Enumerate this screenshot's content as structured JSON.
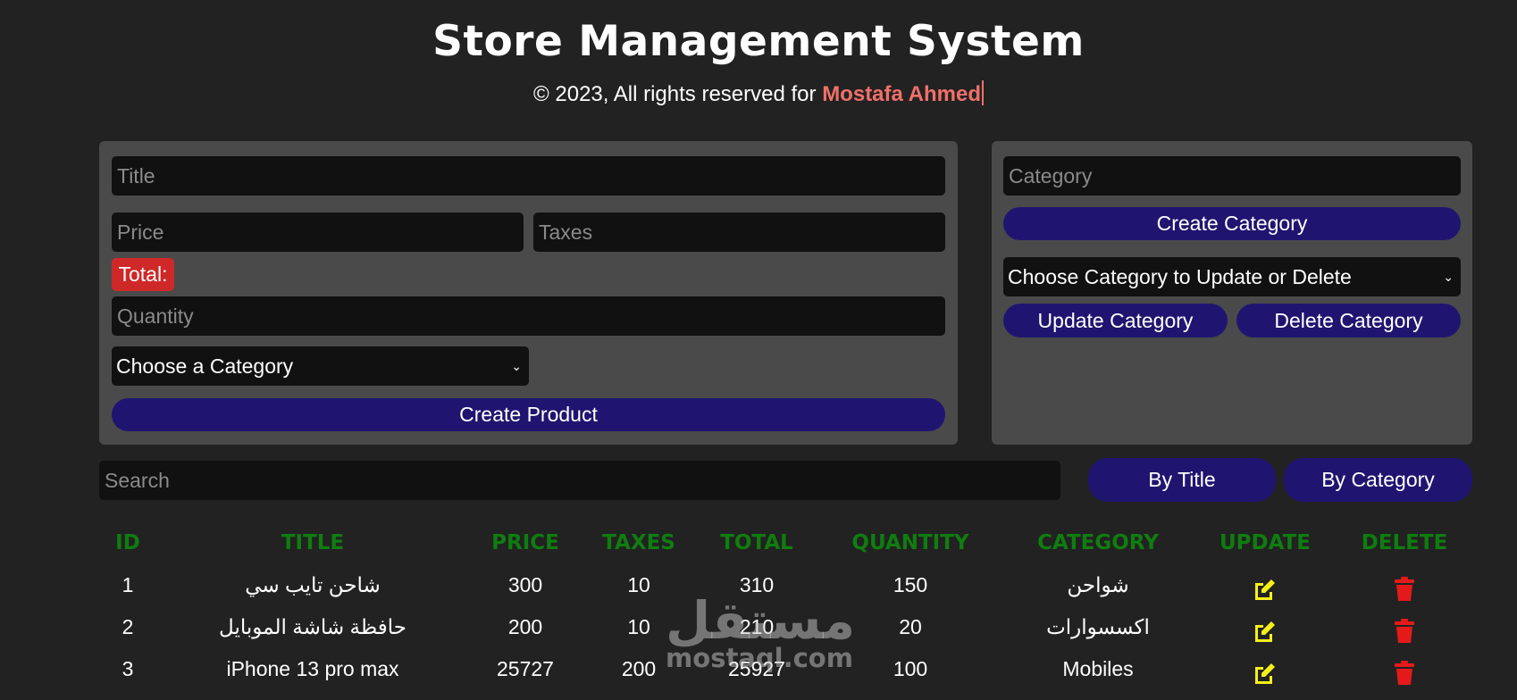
{
  "header": {
    "title": "Store Management System",
    "copyright_prefix": "© 2023, All rights reserved for",
    "author": "Mostafa Ahmed"
  },
  "product_form": {
    "title_placeholder": "Title",
    "price_placeholder": "Price",
    "taxes_placeholder": "Taxes",
    "total_label": "Total:",
    "quantity_placeholder": "Quantity",
    "category_select_value": "Choose a Category",
    "create_button": "Create Product"
  },
  "category_form": {
    "category_placeholder": "Category",
    "create_button": "Create Category",
    "select_value": "Choose Category to Update or Delete",
    "update_button": "Update Category",
    "delete_button": "Delete Category"
  },
  "search": {
    "placeholder": "Search",
    "by_title_button": "By Title",
    "by_category_button": "By Category"
  },
  "table": {
    "headers": [
      "ID",
      "TITLE",
      "PRICE",
      "TAXES",
      "TOTAL",
      "QUANTITY",
      "CATEGORY",
      "UPDATE",
      "DELETE"
    ],
    "rows": [
      {
        "id": "1",
        "title": "شاحن تايب سي",
        "price": "300",
        "taxes": "10",
        "total": "310",
        "quantity": "150",
        "category": "شواحن"
      },
      {
        "id": "2",
        "title": "حافظة شاشة الموبايل",
        "price": "200",
        "taxes": "10",
        "total": "210",
        "quantity": "20",
        "category": "اكسسوارات"
      },
      {
        "id": "3",
        "title": "iPhone 13 pro max",
        "price": "25727",
        "taxes": "200",
        "total": "25927",
        "quantity": "100",
        "category": "Mobiles"
      }
    ]
  },
  "watermark": {
    "logo": "مستقل",
    "url": "mostaql.com"
  },
  "colors": {
    "background": "#222222",
    "panel": "#4a4a4a",
    "field": "#111111",
    "button": "#1f1570",
    "header_text": "#0f7d0f",
    "author": "#f0706a",
    "total_badge": "#cf2828",
    "edit_icon": "#f5f017",
    "delete_icon": "#e41a1a"
  },
  "icons": {
    "update": "edit-icon",
    "delete": "trash-icon",
    "select_arrow": "chevron-down-icon"
  }
}
